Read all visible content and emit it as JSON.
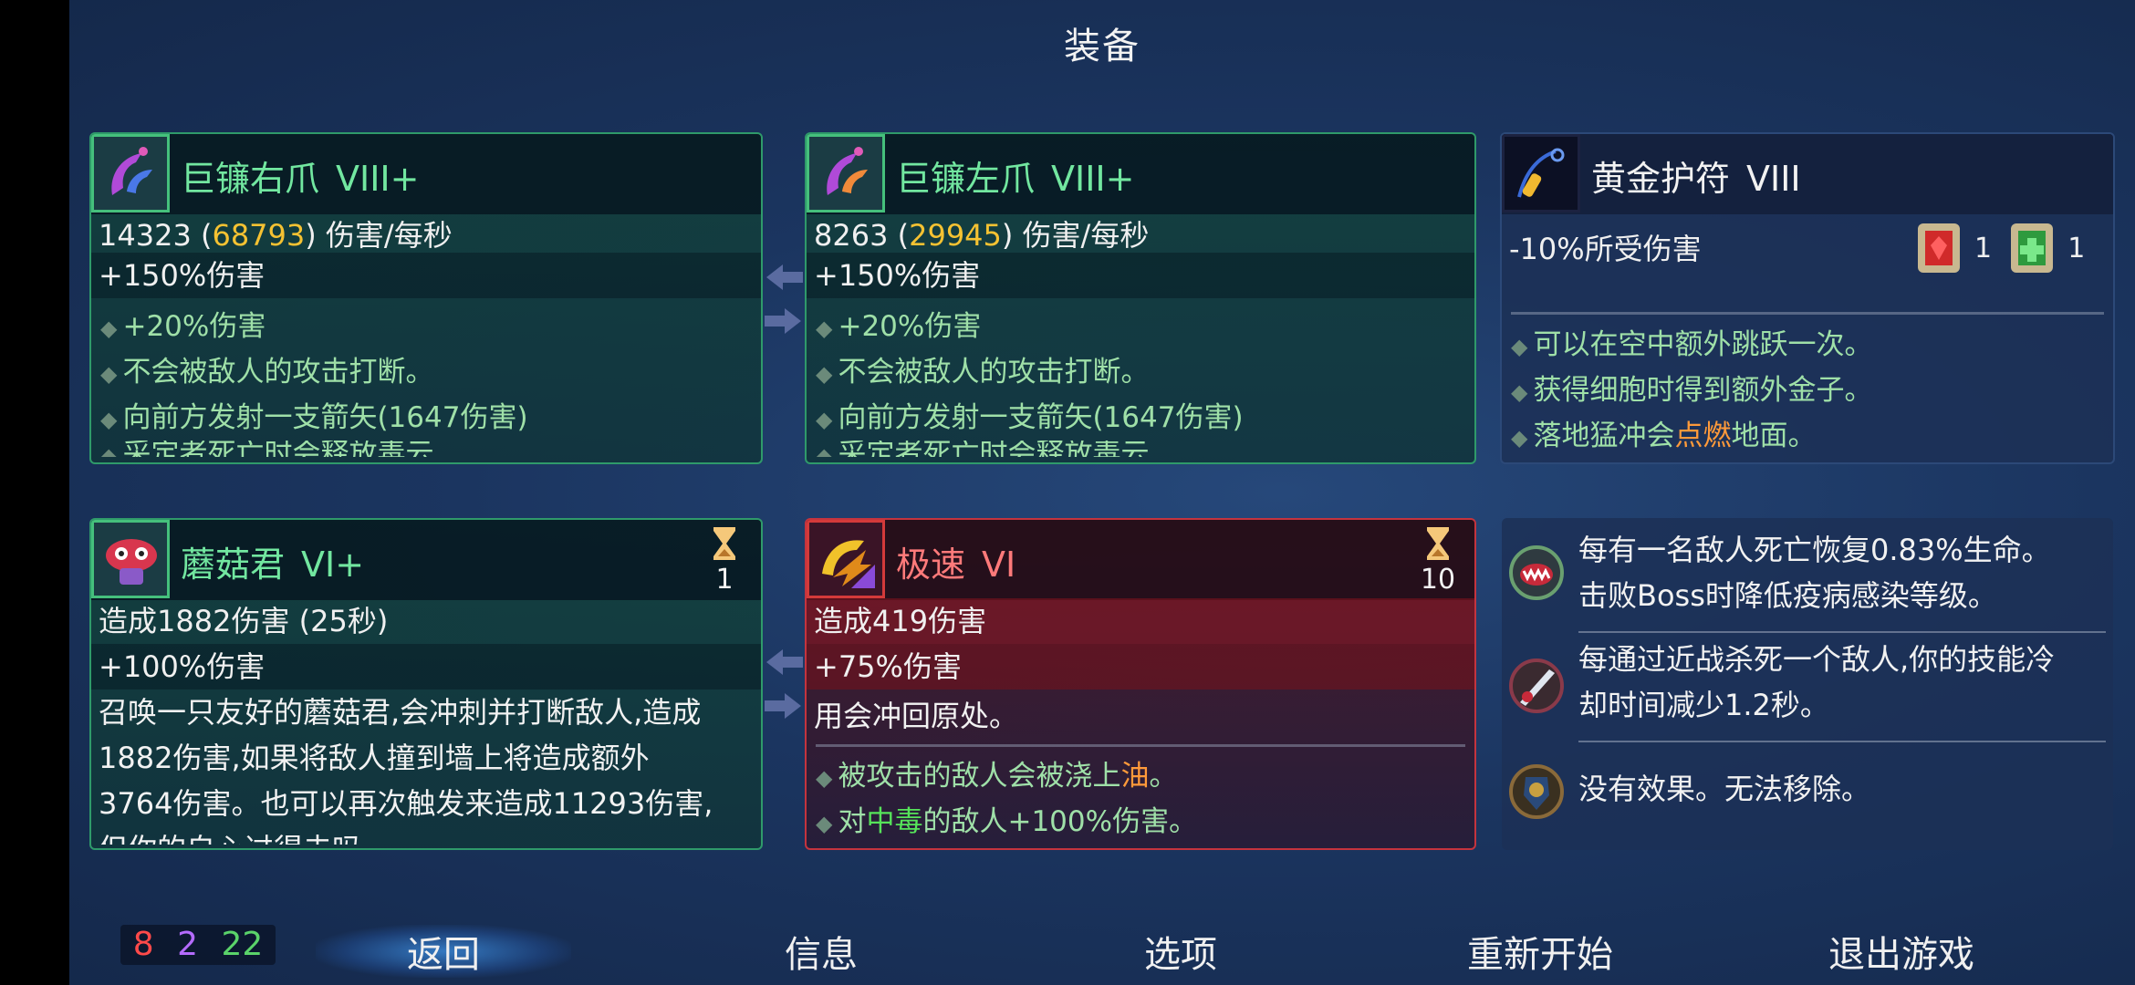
{
  "title": "装备",
  "weapon1": {
    "name": "巨镰右爪",
    "tier": "VIII+",
    "dps_base": "14323",
    "dps_crit": "68793",
    "dps_unit": "伤害/每秒",
    "bonus": "+150%伤害",
    "perks": [
      "+20%伤害",
      "不会被敌人的攻击打断。",
      "向前方发射一支箭矢(1647伤害)",
      "采定者死亡时会释放毒云"
    ]
  },
  "weapon2": {
    "name": "巨镰左爪",
    "tier": "VIII+",
    "dps_base": "8263",
    "dps_crit": "29945",
    "dps_unit": "伤害/每秒",
    "bonus": "+150%伤害",
    "perks": [
      "+20%伤害",
      "不会被敌人的攻击打断。",
      "向前方发射一支箭矢(1647伤害)",
      "采定者死亡时会释放毒云"
    ]
  },
  "amulet": {
    "name": "黄金护符",
    "tier": "VIII",
    "stat": "-10%所受伤害",
    "scroll_red_count": "1",
    "scroll_green_count": "1",
    "perks": [
      "可以在空中额外跳跃一次。",
      "获得细胞时得到额外金子。"
    ],
    "perk3_pre": "落地猛冲会",
    "perk3_hl": "点燃",
    "perk3_post": "地面。"
  },
  "skill1": {
    "name": "蘑菇君",
    "tier": "VI+",
    "count": "1",
    "stat": "造成1882伤害 (25秒)",
    "bonus": "+100%伤害",
    "desc_lines": [
      "召唤一只友好的蘑菇君,会冲刺并打断敌人,造成",
      "1882伤害,如果将敌人撞到墙上将造成额外",
      "3764伤害。也可以再次触发来造成11293伤害,",
      "但你的自心过得去吗"
    ]
  },
  "skill2": {
    "name": "极速",
    "tier": "VI",
    "count": "10",
    "stat": "造成419伤害",
    "bonus": "+75%伤害",
    "desc": "用会冲回原处。",
    "perk1_pre": "被攻击的敌人会被浇上",
    "perk1_hl": "油",
    "perk1_post": "。",
    "perk2_pre": "对",
    "perk2_hl": "中毒",
    "perk2_post": "的敌人+100%伤害。"
  },
  "mutations": [
    {
      "icon": "vampire-mouth-icon",
      "lines": [
        "每有一名敌人死亡恢复0.83%生命。",
        "击败Boss时降低疫病感染等级。"
      ]
    },
    {
      "icon": "sword-blood-icon",
      "lines": [
        "每通过近战杀死一个敌人,你的技能冷",
        "却时间减少1.2秒。"
      ]
    },
    {
      "icon": "shield-mask-icon",
      "lines": [
        "没有效果。无法移除。"
      ]
    }
  ],
  "counters": {
    "red": "8",
    "purple": "2",
    "green": "22"
  },
  "menu": {
    "back": "返回",
    "info": "信息",
    "options": "选项",
    "restart": "重新开始",
    "quit": "退出游戏"
  }
}
